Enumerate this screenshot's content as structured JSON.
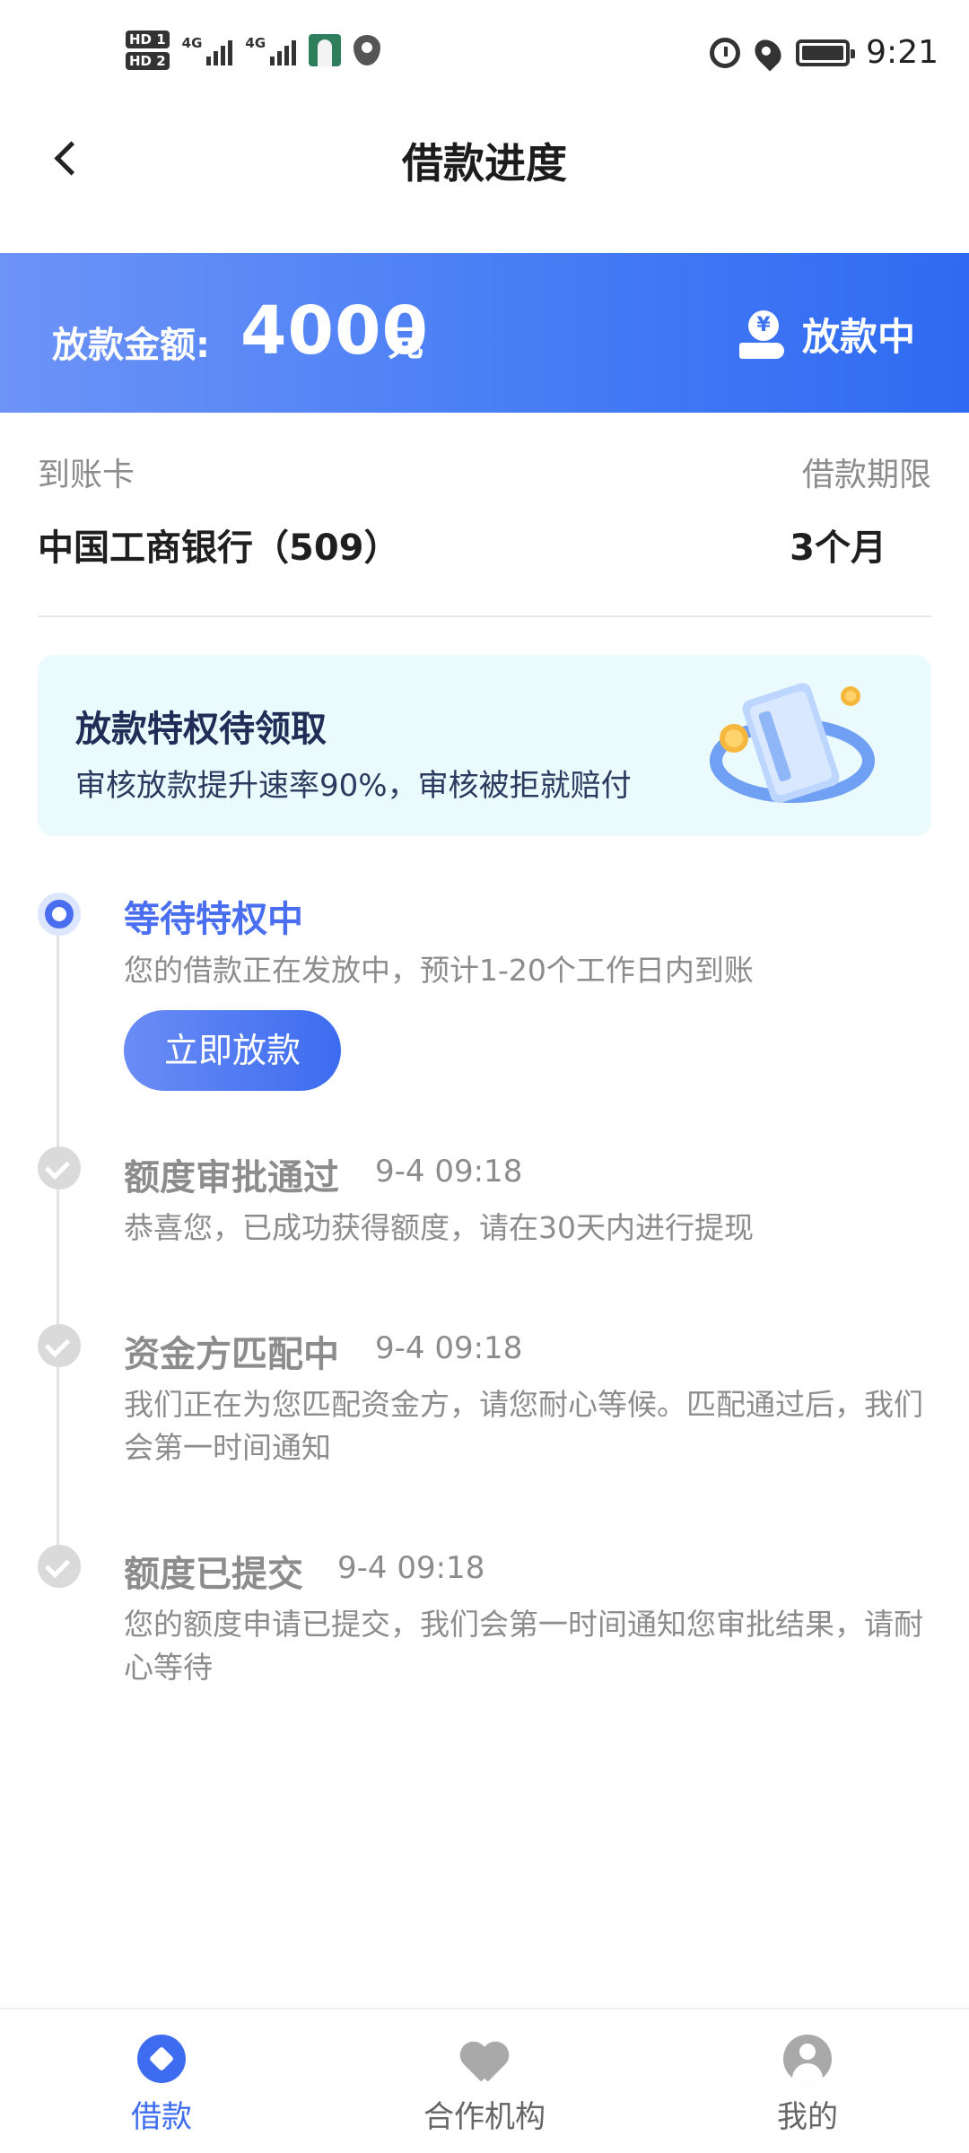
{
  "status_bar": {
    "hd1": "HD 1",
    "hd2": "HD 2",
    "net1": "4G",
    "net2": "4G",
    "time": "9:21"
  },
  "nav": {
    "title": "借款进度"
  },
  "banner": {
    "label": "放款金额:",
    "amount": "4000",
    "unit": "元",
    "status": "放款中",
    "status_icon_glyph": "¥"
  },
  "info": {
    "card_label": "到账卡",
    "card_value": "中国工商银行（509）",
    "term_label": "借款期限",
    "term_value": "3个月"
  },
  "privilege": {
    "title": "放款特权待领取",
    "subtitle": "审核放款提升速率90%，审核被拒就赔付"
  },
  "steps": [
    {
      "title": "等待特权中",
      "time": "",
      "desc": "您的借款正在发放中，预计1-20个工作日内到账",
      "button": "立即放款"
    },
    {
      "title": "额度审批通过",
      "time": "9-4 09:18",
      "desc": "恭喜您，已成功获得额度，请在30天内进行提现"
    },
    {
      "title": "资金方匹配中",
      "time": "9-4 09:18",
      "desc": "我们正在为您匹配资金方，请您耐心等候。匹配通过后，我们会第一时间通知"
    },
    {
      "title": "额度已提交",
      "time": "9-4 09:18",
      "desc": "您的额度申请已提交，我们会第一时间通知您审批结果，请耐心等待"
    }
  ],
  "tabs": [
    {
      "label": "借款",
      "icon": "loan-icon",
      "active": true
    },
    {
      "label": "合作机构",
      "icon": "partner-icon",
      "active": false
    },
    {
      "label": "我的",
      "icon": "profile-icon",
      "active": false
    }
  ],
  "colors": {
    "accent": "#3d6cf0",
    "banner_start": "#6d93f7",
    "banner_end": "#2f6af2",
    "muted_text": "#8c8c8c",
    "privilege_bg": "#eafafd"
  }
}
